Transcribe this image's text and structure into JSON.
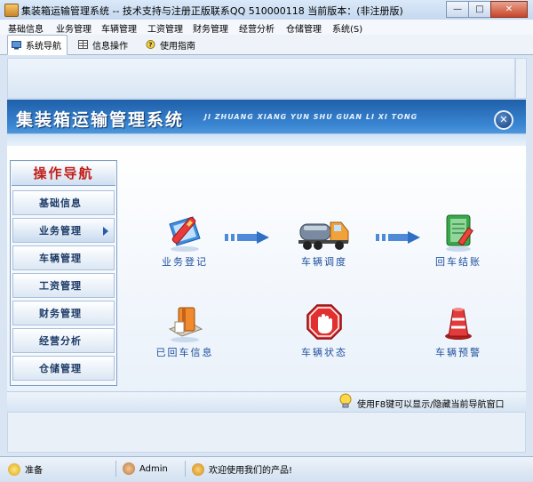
{
  "window": {
    "title": "集装箱运输管理系统 -- 技术支持与注册正版联系QQ 510000118    当前版本：(非注册版)",
    "minimize_icon": "minimize-icon",
    "maximize_icon": "maximize-icon",
    "close_icon": "close-icon"
  },
  "menu": [
    {
      "label": "基础信息"
    },
    {
      "label": "业务管理"
    },
    {
      "label": "车辆管理"
    },
    {
      "label": "工资管理"
    },
    {
      "label": "财务管理"
    },
    {
      "label": "经营分析"
    },
    {
      "label": "仓储管理"
    },
    {
      "label": "系统(S)"
    }
  ],
  "tabs": [
    {
      "label": "系统导航",
      "active": true
    },
    {
      "label": "信息操作",
      "active": false
    },
    {
      "label": "使用指南",
      "active": false
    }
  ],
  "banner": {
    "title_cn": "集装箱运输管理系统",
    "title_en": "JI ZHUANG XIANG YUN SHU GUAN LI XI TONG",
    "close_symbol": "✕"
  },
  "nav": {
    "title": "操作导航",
    "items": [
      {
        "label": "基础信息"
      },
      {
        "label": "业务管理",
        "selected": true
      },
      {
        "label": "车辆管理"
      },
      {
        "label": "工资管理"
      },
      {
        "label": "财务管理"
      },
      {
        "label": "经营分析"
      },
      {
        "label": "仓储管理"
      }
    ]
  },
  "features": {
    "business_register": {
      "label": "业务登记",
      "icon": "register-icon"
    },
    "vehicle_dispatch": {
      "label": "车辆调度",
      "icon": "truck-icon"
    },
    "return_settle": {
      "label": "回车结账",
      "icon": "ledger-icon"
    },
    "returned_info": {
      "label": "已回车信息",
      "icon": "books-icon"
    },
    "vehicle_status": {
      "label": "车辆状态",
      "icon": "stop-hand-icon"
    },
    "vehicle_alert": {
      "label": "车辆预警",
      "icon": "alarm-icon"
    }
  },
  "hint": {
    "text": "使用F8键可以显示/隐藏当前导航窗口"
  },
  "status": {
    "ready": "准备",
    "user": "Admin",
    "welcome": "欢迎使用我们的产品!"
  },
  "colors": {
    "accent": "#1d4f9c",
    "nav_title": "#c0201a",
    "banner": "#2c6fbf"
  }
}
